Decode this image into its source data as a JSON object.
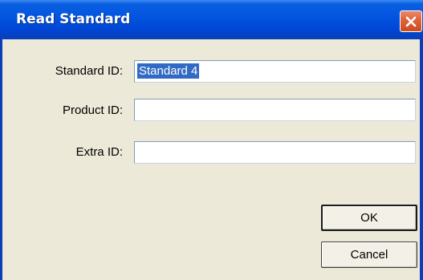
{
  "window": {
    "title": "Read Standard"
  },
  "form": {
    "standard_id": {
      "label": "Standard ID:",
      "value": "Standard 4"
    },
    "product_id": {
      "label": "Product ID:",
      "value": ""
    },
    "extra_id": {
      "label": "Extra ID:",
      "value": ""
    }
  },
  "buttons": {
    "ok": "OK",
    "cancel": "Cancel"
  },
  "icons": {
    "close": "close-icon"
  },
  "colors": {
    "titlebar": "#0054e3",
    "window_bg": "#ece9d8",
    "selection": "#316ac5",
    "close_button": "#e0643b"
  }
}
